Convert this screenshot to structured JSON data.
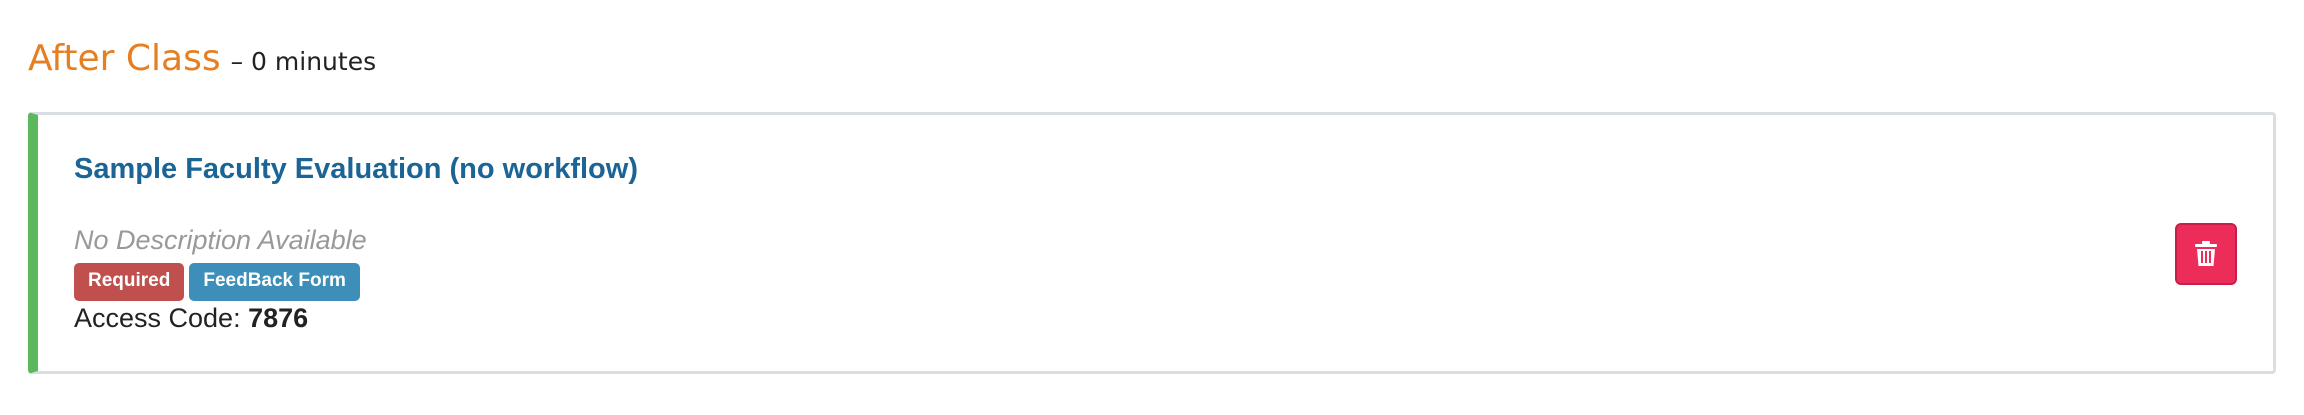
{
  "section": {
    "title": "After Class",
    "duration": "– 0 minutes"
  },
  "card": {
    "title": "Sample Faculty Evaluation (no workflow)",
    "description": "No Description Available",
    "badges": {
      "required": "Required",
      "type": "FeedBack Form"
    },
    "access_code_label": "Access Code: ",
    "access_code_value": "7876",
    "delete_icon": "trash-icon"
  },
  "colors": {
    "section_title": "#e67e22",
    "card_accent": "#5cb85c",
    "card_title": "#1a6496",
    "badge_required": "#c0504d",
    "badge_feedback": "#3d8eb9",
    "delete_button": "#ec2d5a"
  }
}
